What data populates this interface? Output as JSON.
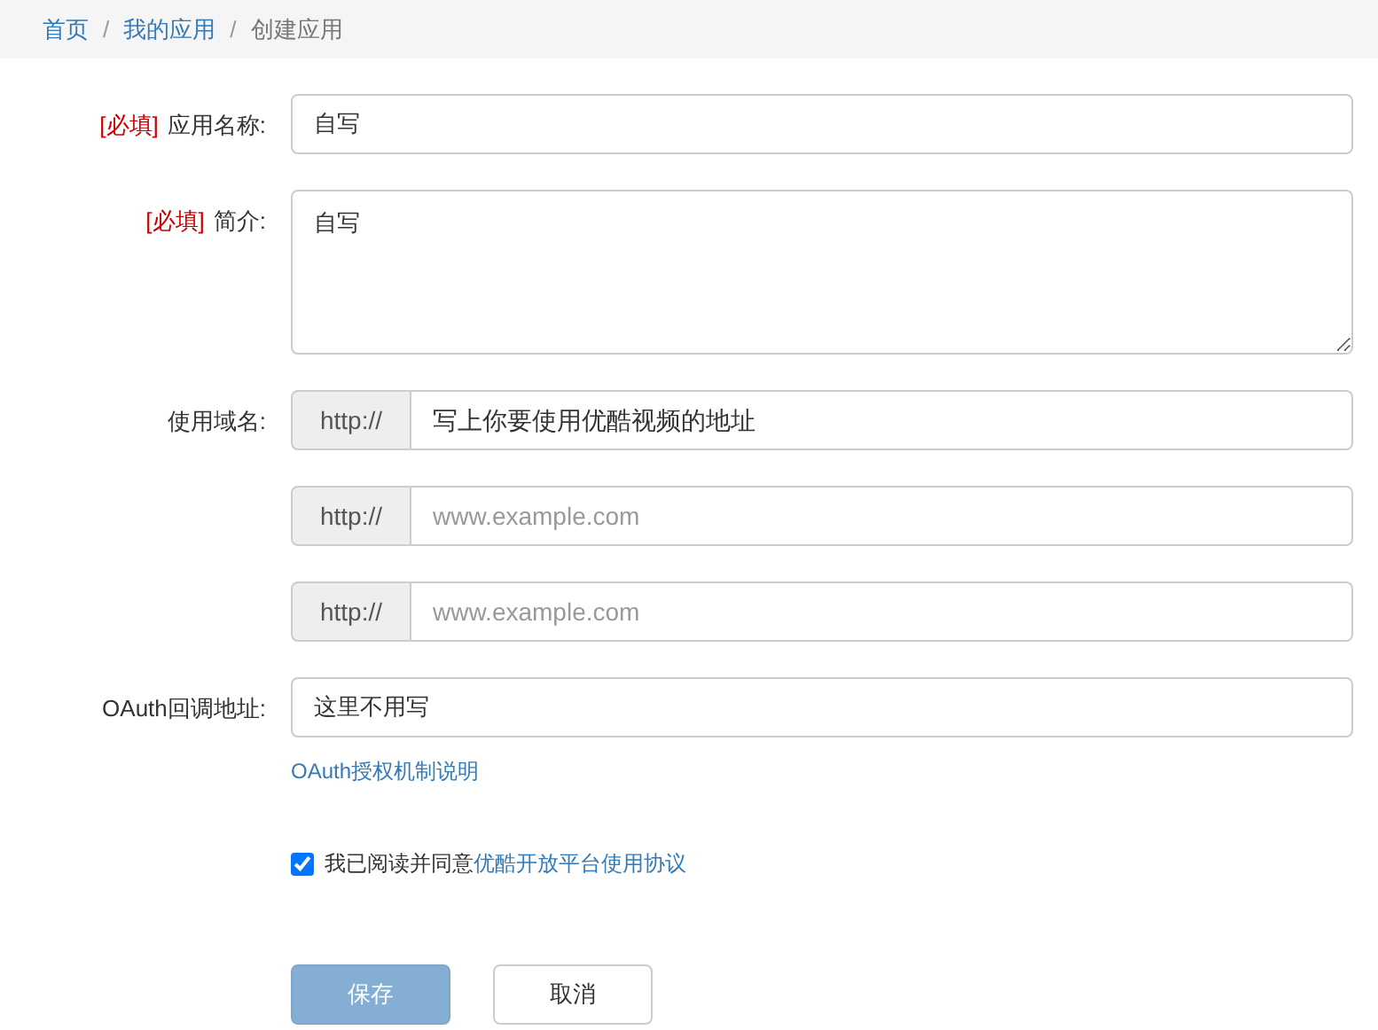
{
  "breadcrumb": [
    {
      "label": "首页",
      "link": true
    },
    {
      "label": "我的应用",
      "link": true
    },
    {
      "label": "创建应用",
      "link": false
    }
  ],
  "breadcrumb_separator": "/",
  "name_field": {
    "required_tag": "[必填]",
    "label": "应用名称:",
    "value": "自写"
  },
  "intro_field": {
    "required_tag": "[必填]",
    "label": "简介:",
    "value": "自写"
  },
  "domain": {
    "label": "使用域名:",
    "rows": [
      {
        "prefix": "http://",
        "value": "写上你要使用优酷视频的地址"
      },
      {
        "prefix": "http://",
        "placeholder": "www.example.com"
      },
      {
        "prefix": "http://",
        "placeholder": "www.example.com"
      }
    ]
  },
  "oauth": {
    "label": "OAuth回调地址:",
    "value": "这里不用写",
    "help_link": "OAuth授权机制说明"
  },
  "agreement": {
    "checked": true,
    "text": "我已阅读并同意",
    "link": "优酷开放平台使用协议"
  },
  "buttons": [
    {
      "label": "保存",
      "kind": "primary",
      "disabled": true
    },
    {
      "label": "取消",
      "kind": "default",
      "disabled": false
    }
  ]
}
